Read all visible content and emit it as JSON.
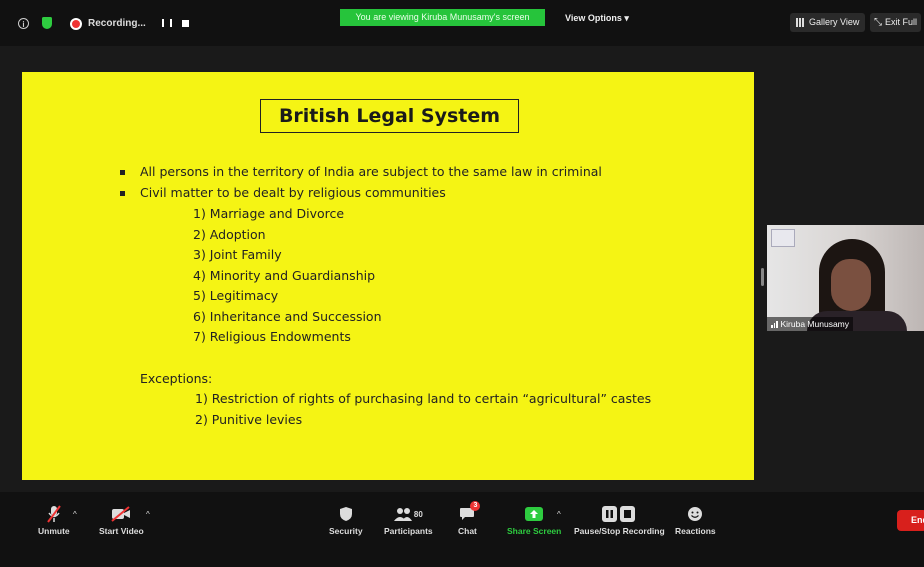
{
  "topbar": {
    "recording_label": "Recording...",
    "viewing_banner": "You are viewing Kiruba Munusamy's screen",
    "view_options": "View Options",
    "gallery_view": "Gallery View",
    "exit_full": "Exit Full"
  },
  "slide": {
    "title": "British Legal System",
    "bullets": [
      "All persons in the territory of India are subject to the same law in criminal",
      "Civil matter to be dealt by religious communities"
    ],
    "civil_items": [
      "1) Marriage and Divorce",
      "2) Adoption",
      "3) Joint Family",
      "4) Minority and Guardianship",
      "5) Legitimacy",
      "6) Inheritance and Succession",
      "7) Religious Endowments"
    ],
    "exceptions_heading": "Exceptions:",
    "exceptions": [
      "1) Restriction of rights of purchasing land to certain “agricultural” castes",
      "2) Punitive levies"
    ]
  },
  "participant": {
    "name": "Kiruba Munusamy"
  },
  "toolbar": {
    "unmute": "Unmute",
    "start_video": "Start Video",
    "security": "Security",
    "participants": "Participants",
    "participants_count": "80",
    "chat": "Chat",
    "chat_badge": "3",
    "share_screen": "Share Screen",
    "pause_stop_recording": "Pause/Stop Recording",
    "reactions": "Reactions",
    "end": "End"
  },
  "colors": {
    "slide_bg": "#f5f414",
    "share_green": "#26c43b",
    "end_red": "#d8201c"
  }
}
